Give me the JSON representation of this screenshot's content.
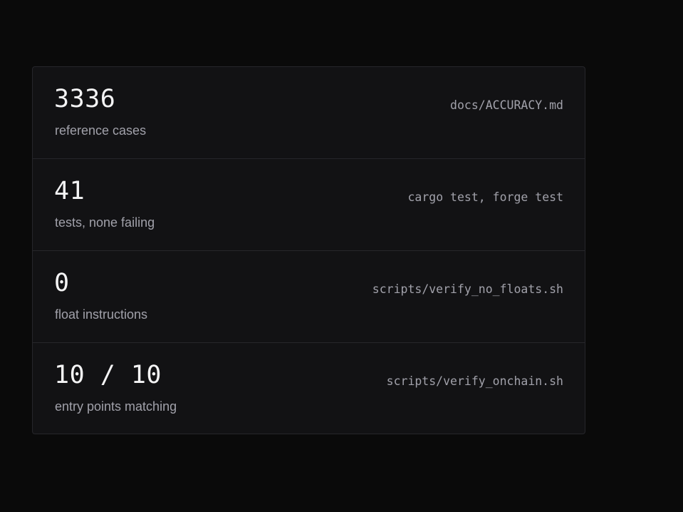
{
  "stats": {
    "items": [
      {
        "value": "3336",
        "label": "reference cases",
        "source": "docs/ACCURACY.md"
      },
      {
        "value": "41",
        "label": "tests, none failing",
        "source": "cargo test, forge test"
      },
      {
        "value": "0",
        "label": "float instructions",
        "source": "scripts/verify_no_floats.sh"
      },
      {
        "value": "10 / 10",
        "label": "entry points matching",
        "source": "scripts/verify_onchain.sh"
      }
    ]
  },
  "colors": {
    "background": "#0a0a0a",
    "card": "#121214",
    "border": "#26262a",
    "value_text": "#f4f4f5",
    "muted_text": "#a1a1aa"
  }
}
